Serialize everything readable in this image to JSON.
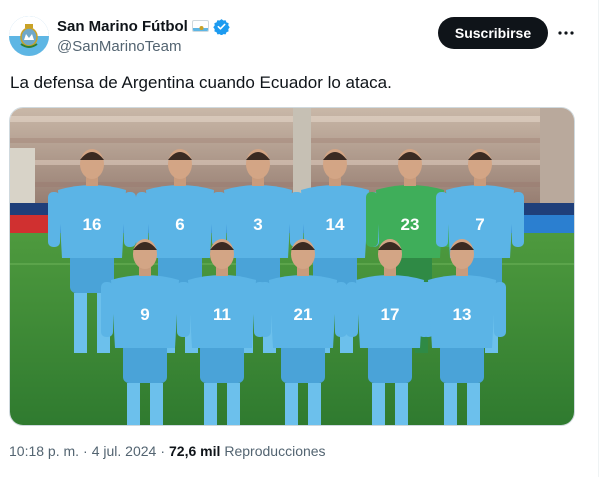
{
  "author": {
    "display_name": "San Marino Fútbol",
    "handle": "@SanMarinoTeam",
    "flag_icon": "san-marino-flag",
    "verified_icon": "verified-badge-icon",
    "verified_color": "#1d9bf0"
  },
  "actions": {
    "subscribe_label": "Suscribirse",
    "more_icon": "more-options-icon"
  },
  "tweet": {
    "text": "La defensa de Argentina cuando Ecuador lo ataca."
  },
  "media": {
    "jersey_numbers_back_row": [
      "16",
      "6",
      "3",
      "14",
      "23",
      "7"
    ],
    "jersey_numbers_front_row": [
      "9",
      "11",
      "21",
      "17",
      "13"
    ]
  },
  "meta": {
    "time": "10:18 p. m.",
    "separator_1": "·",
    "date": "4 jul. 2024",
    "separator_2": "·",
    "views_count": "72,6 mil",
    "views_label": "Reproducciones"
  },
  "colors": {
    "kit_blue": "#5bb4e6",
    "keeper_green": "#3fae5a",
    "pitch_green": "#3f8f3a",
    "button_bg": "#0f1419",
    "secondary_text": "#536471"
  }
}
